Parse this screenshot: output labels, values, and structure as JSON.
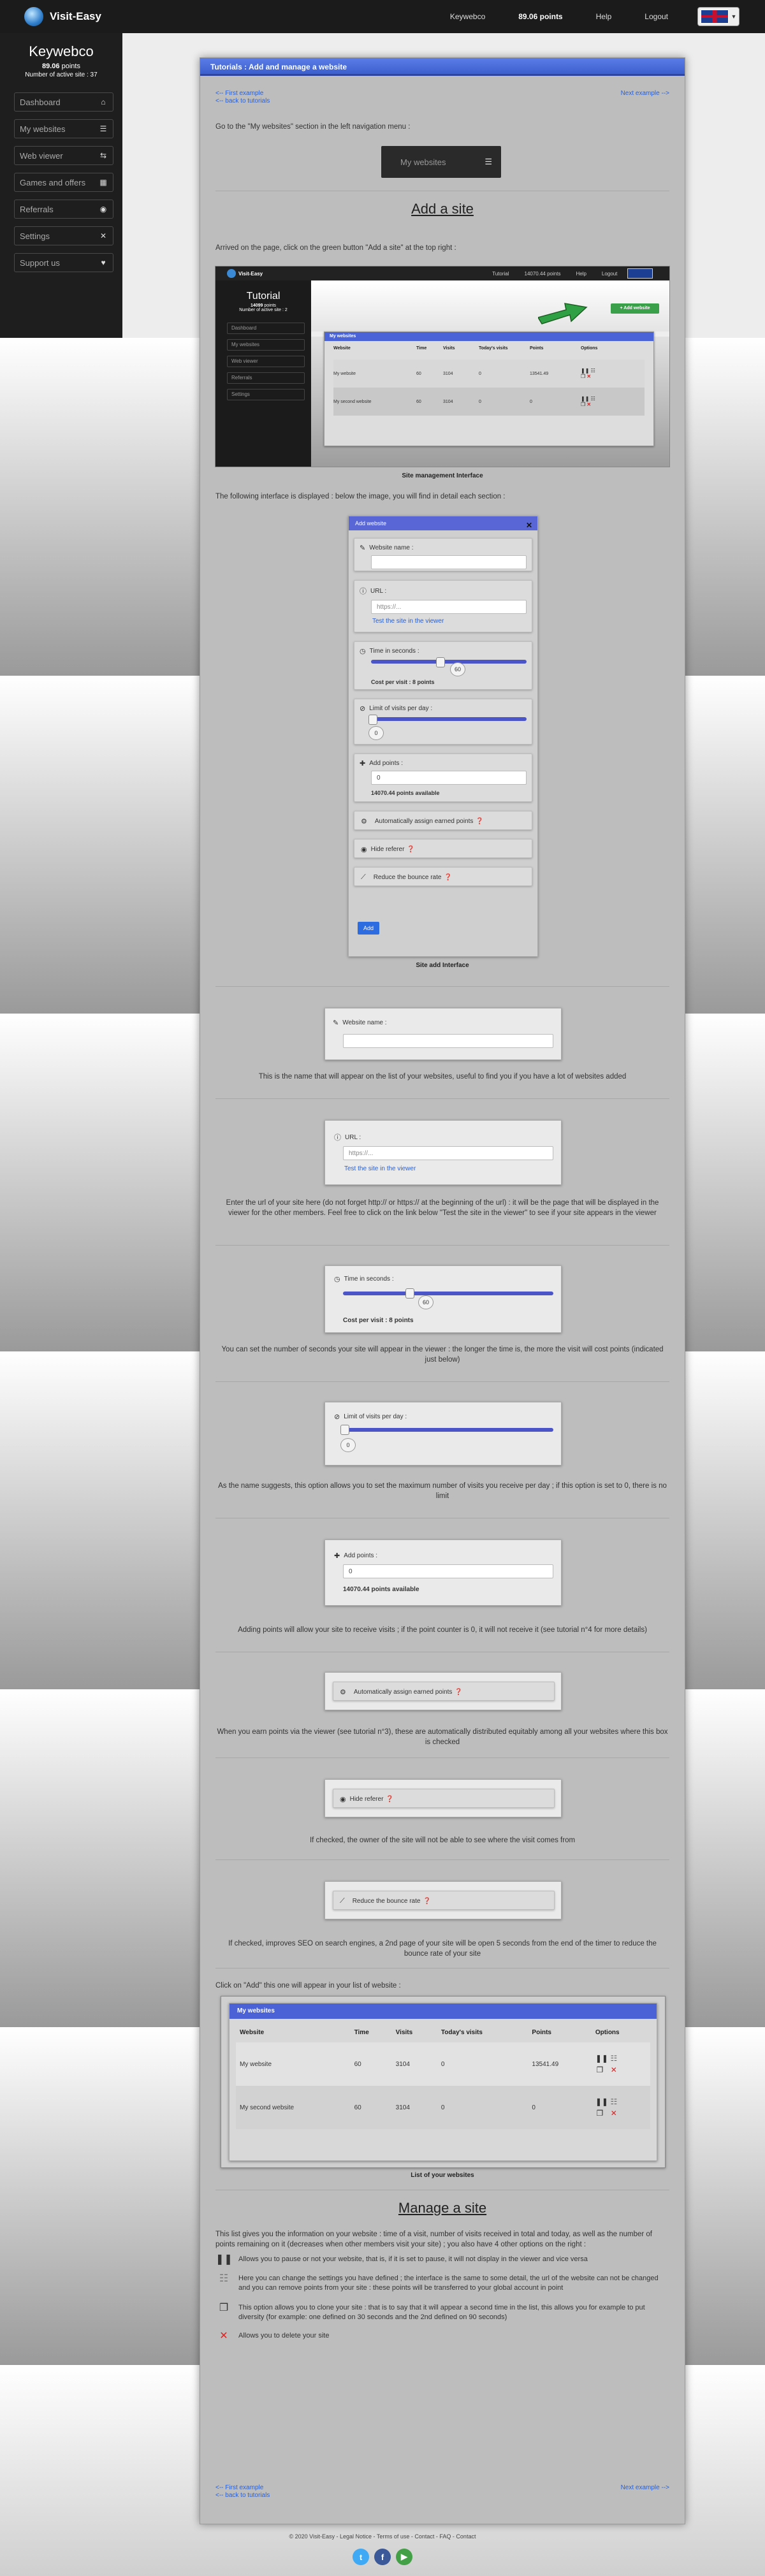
{
  "topbar": {
    "brand": "Visit-Easy",
    "keywebco": "Keywebco",
    "points": "89.06 points",
    "help": "Help",
    "logout": "Logout"
  },
  "sidebar": {
    "username": "Keywebco",
    "points_value": "89.06",
    "points_suffix": "points",
    "active_sites": "Number of active site : 37",
    "items": [
      {
        "label": "Dashboard",
        "icon": "home-icon",
        "glyph": "⌂"
      },
      {
        "label": "My websites",
        "icon": "list-icon",
        "glyph": "☰"
      },
      {
        "label": "Web viewer",
        "icon": "sliders-icon",
        "glyph": "⇆"
      },
      {
        "label": "Games and offers",
        "icon": "grid-icon",
        "glyph": "▦"
      },
      {
        "label": "Referrals",
        "icon": "eye-icon",
        "glyph": "◉"
      },
      {
        "label": "Settings",
        "icon": "tools-icon",
        "glyph": "✕"
      },
      {
        "label": "Support us",
        "icon": "heart-icon",
        "glyph": "♥"
      }
    ]
  },
  "page": {
    "header": "Tutorials : Add and manage a website",
    "first_example": "<-- First example",
    "back_tutorials": "<-- back to tutorials",
    "next_example": "Next example -->",
    "intro": "Go to the \"My websites\" section in the left navigation menu :",
    "my_websites_btn": "My websites",
    "add_site_title": "Add a site",
    "arrived_text": "Arrived on the page, click on the green button \"Add a site\" at the top right :",
    "site_mgmt_caption": "Site management Interface",
    "following_text": "The following interface is displayed : below the image, you will find in detail each section :",
    "site_add_caption": "Site add Interface",
    "website_name_label": "Website name :",
    "url_label": "URL :",
    "url_placeholder": "https://...",
    "test_link": "Test the site in the viewer",
    "time_label": "Time in seconds :",
    "time_value": "60",
    "cost_text": "Cost per visit : 8 points",
    "limit_label": "Limit of visits per day :",
    "limit_value": "0",
    "add_points_label": "Add points :",
    "add_points_value": "0",
    "points_available": "14070.44 points available",
    "auto_assign": "Automatically assign earned points",
    "hide_referer": "Hide referer",
    "reduce_bounce": "Reduce the bounce rate",
    "add_btn": "Add",
    "modal_title": "Add website",
    "desc_name": "This is the name that will appear on the list of your websites, useful to find you if you have a lot of websites added",
    "desc_url": "Enter the url of your site here (do not forget http:// or https:// at the beginning of the url) : it will be the page that will be displayed in the viewer for the other members. Feel free to click on the link below \"Test the site in the viewer\" to see if your site appears in the viewer",
    "desc_time": "You can set the number of seconds your site will appear in the viewer : the longer the time is, the more the visit will cost points (indicated just below)",
    "desc_limit": "As the name suggests, this option allows you to set the maximum number of visits you receive per day ; if this option is set to 0, there is no limit",
    "desc_points": "Adding points will allow your site to receive visits ; if the point counter is 0, it will not receive it (see tutorial n°4 for more details)",
    "desc_auto": "When you earn points via the viewer (see tutorial n°3), these are automatically distributed equitably among all your websites where this box is checked",
    "desc_referer": "If checked, the owner of the site will not be able to see where the visit comes from",
    "desc_bounce": "If checked, improves SEO on search engines, a 2nd page of your site will be open 5 seconds from the end of the timer to reduce the bounce rate of your site",
    "click_add_text": "Click on \"Add\" this one will appear in your list of website :",
    "list_caption": "List of your websites",
    "manage_title": "Manage a site",
    "manage_intro": "This list gives you the information on your website : time of a visit, number of visits received in total and today, as well as the number of points remaining on it (decreases when other members visit your site) ; you also have 4 other options on the right :",
    "legend_pause": "Allows you to pause or not your website, that is, if it is set to pause, it will not display in the viewer and vice versa",
    "legend_settings": "Here you can change the settings you have defined ; the interface is the same to some detail, the url of the website can not be changed and you can remove points from your site : these points will be transferred to your global account in point",
    "legend_clone": "This option allows you to clone your site : that is to say that it will appear a second time in the list, this allows you for example to put diversity (for example: one defined on 30 seconds and the 2nd defined on 90 seconds)",
    "legend_delete": "Allows you to delete your site",
    "footer": "© 2020 Visit-Easy - Legal Notice - Terms of use - Contact - FAQ - Contact"
  },
  "mini": {
    "tutorial": "Tutorial",
    "points": "14099",
    "points_label": "points",
    "active": "Number of active site : 2",
    "nav": [
      "Tutorial",
      "14070.44 points",
      "Help",
      "Logout"
    ],
    "menu": [
      "Dashboard",
      "My websites",
      "Web viewer",
      "Referrals",
      "Settings"
    ],
    "add_btn": "+ Add website",
    "panel_title": "My websites"
  },
  "websites_table": {
    "title": "My websites",
    "headers": [
      "Website",
      "Time",
      "Visits",
      "Today's visits",
      "Points",
      "Options"
    ],
    "rows": [
      [
        "My website",
        "60",
        "3104",
        "0",
        "13541.49"
      ],
      [
        "My second website",
        "60",
        "3104",
        "0",
        "0"
      ]
    ]
  },
  "colors": {
    "accent": "#4b55c8",
    "green": "#3aa14a",
    "dark": "#1e1e1e"
  }
}
